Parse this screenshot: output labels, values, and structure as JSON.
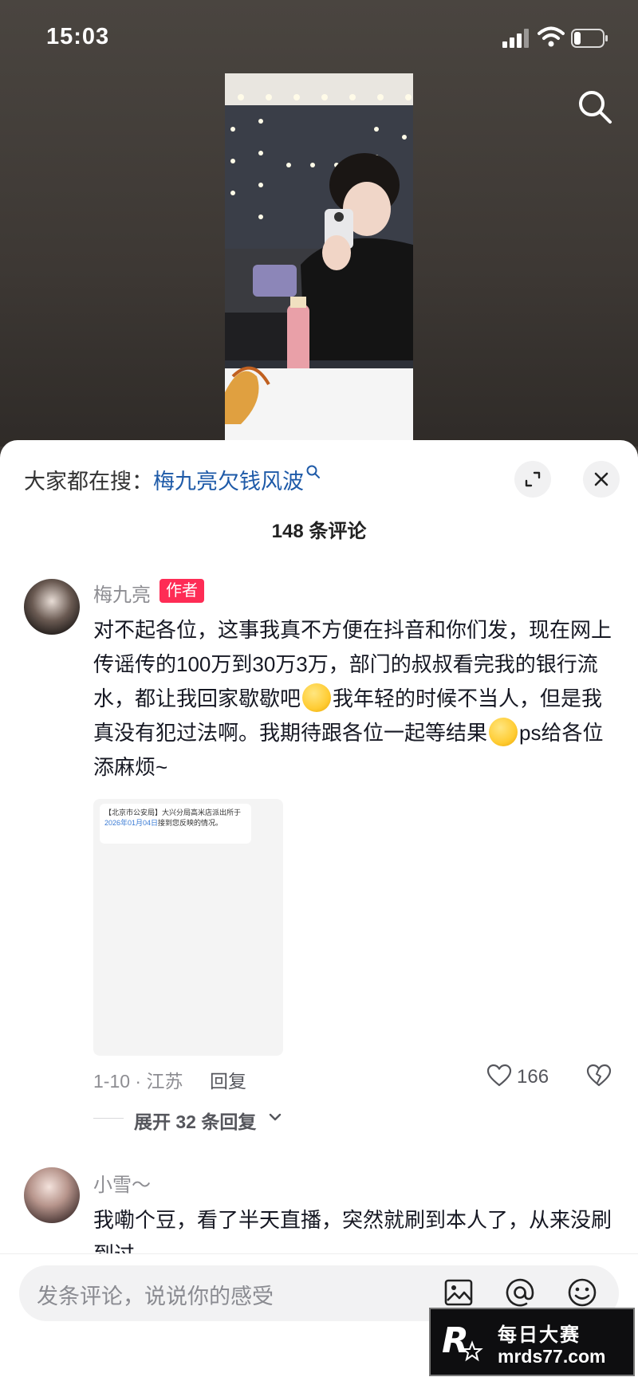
{
  "status_bar": {
    "time": "15:03"
  },
  "comments_panel": {
    "hot_search_prefix": "大家都在搜：",
    "hot_search_keyword": "梅九亮欠钱风波",
    "count_label": "148 条评论",
    "comments": [
      {
        "name": "梅九亮",
        "tag": "作者",
        "text_part1": "对不起各位，这事我真不方便在抖音和你们发，现在网上传谣传的100万到30万3万，部门的叔叔看完我的银行流水，都让我回家歇歇吧",
        "text_part2": "我年轻的时候不当人，但是我真没有犯过法啊。我期待跟各位一起等结果",
        "text_part3": "ps给各位添麻烦~",
        "image_text_1": "【北京市公安局】大兴分局高米店派出所于",
        "image_text_date": "2026年01月04日",
        "image_text_2": "接到您反映的情况。",
        "meta": "1-10 · 江苏",
        "reply_label": "回复",
        "likes": "166",
        "expand_label": "展开 32 条回复"
      },
      {
        "name": "小雪～",
        "text": "我嘞个豆，看了半天直播，突然就刷到本人了，从来没刷到过"
      }
    ]
  },
  "input_bar": {
    "placeholder": "发条评论，说说你的感受"
  },
  "watermark": {
    "line1": "每日大赛",
    "line2": "mrds77.com",
    "logo_text": "R"
  }
}
